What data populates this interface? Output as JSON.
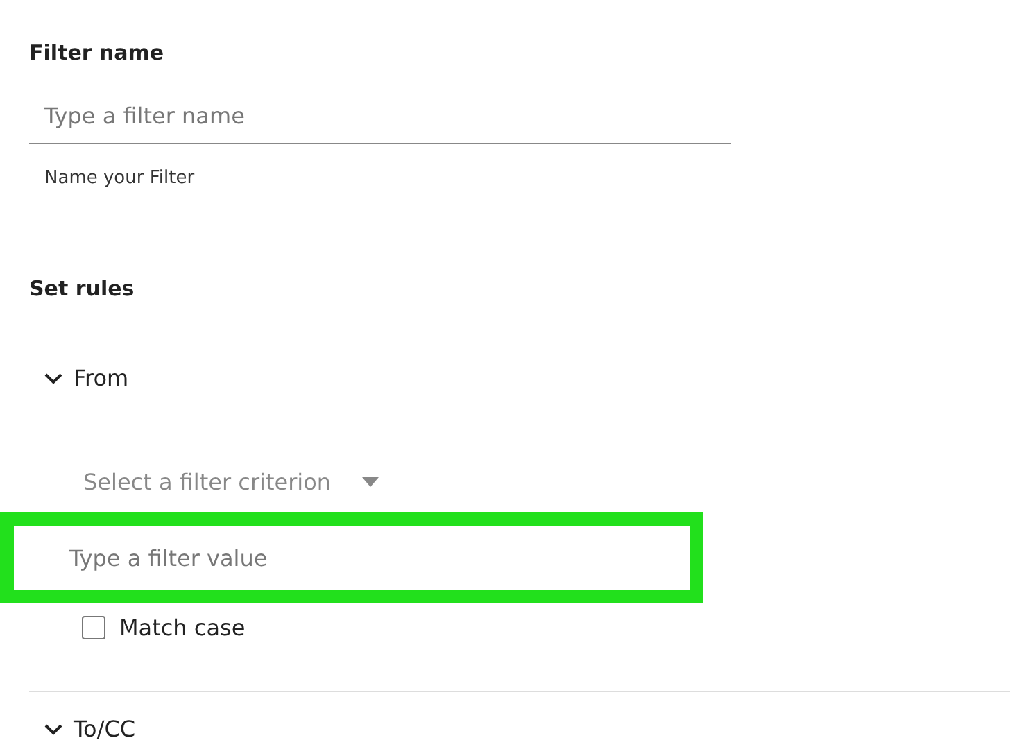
{
  "filter_name": {
    "label": "Filter name",
    "placeholder": "Type a filter name",
    "hint": "Name your Filter"
  },
  "rules": {
    "title": "Set rules",
    "sections": [
      {
        "label": "From",
        "expanded": true,
        "criterion": {
          "placeholder": "Select a filter criterion"
        },
        "value": {
          "placeholder": "Type a filter value",
          "highlighted": true
        },
        "match_case": {
          "label": "Match case",
          "checked": false
        }
      },
      {
        "label": "To/CC",
        "expanded": true
      }
    ]
  }
}
